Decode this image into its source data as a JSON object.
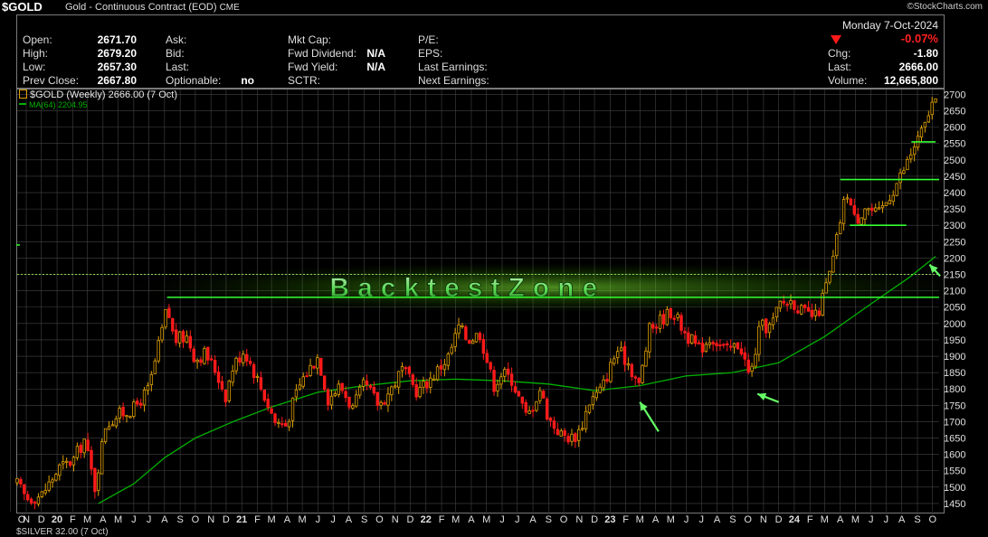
{
  "title": {
    "symbol": "$GOLD",
    "description": "Gold - Continuous Contract (EOD)",
    "exchange": "CME",
    "source": "©StockCharts.com"
  },
  "header": {
    "date": "Monday  7-Oct-2024",
    "change_pct": "-0.07%",
    "open_label": "Open:",
    "open": "2671.70",
    "high_label": "High:",
    "high": "2679.20",
    "low_label": "Low:",
    "low": "2657.30",
    "prev_label": "Prev Close:",
    "prev": "2667.80",
    "ask_label": "Ask:",
    "bid_label": "Bid:",
    "last_label": "Last:",
    "optionable_label": "Optionable:",
    "optionable": "no",
    "mktcap_label": "Mkt Cap:",
    "fwddiv_label": "Fwd Dividend:",
    "fwddiv": "N/A",
    "fwdyield_label": "Fwd Yield:",
    "fwdyield": "N/A",
    "sctr_label": "SCTR:",
    "pe_label": "P/E:",
    "eps_label": "EPS:",
    "lastearn_label": "Last Earnings:",
    "nextearn_label": "Next Earnings:",
    "chg_label": "Chg:",
    "chg": "-1.80",
    "last2_label": "Last:",
    "last2": "2666.00",
    "volume_label": "Volume:",
    "volume": "12,665,800"
  },
  "legend": {
    "price": "$GOLD (Weekly) 2666.00 (7 Oct)",
    "ma": "MA(64) 2204.95"
  },
  "watermark": "BacktestZone",
  "footer": "$SILVER 32.00 (7 Oct)",
  "colors": {
    "up": "#e0a000",
    "down": "#ff1a1a",
    "ma": "#00b000",
    "level": "#33ff33",
    "arrow": "#66ff66",
    "grid": "#444444",
    "axis_text": "#e0e0e0"
  },
  "chart_data": {
    "type": "candlestick",
    "ylim": [
      1425,
      2715
    ],
    "yticks": [
      1450,
      1500,
      1550,
      1600,
      1650,
      1700,
      1750,
      1800,
      1850,
      1900,
      1950,
      2000,
      2050,
      2100,
      2150,
      2200,
      2250,
      2300,
      2350,
      2400,
      2450,
      2500,
      2550,
      2600,
      2650,
      2700
    ],
    "x_range": [
      "2019-10-14",
      "2024-10-14"
    ],
    "x_ticks": [
      {
        "label": "O",
        "date": "2019-10-01"
      },
      {
        "label": "N",
        "date": "2019-11-01"
      },
      {
        "label": "D",
        "date": "2019-12-01"
      },
      {
        "label": "20",
        "date": "2020-01-01"
      },
      {
        "label": "F",
        "date": "2020-02-01"
      },
      {
        "label": "M",
        "date": "2020-03-01"
      },
      {
        "label": "A",
        "date": "2020-04-01"
      },
      {
        "label": "M",
        "date": "2020-05-01"
      },
      {
        "label": "J",
        "date": "2020-06-01"
      },
      {
        "label": "J",
        "date": "2020-07-01"
      },
      {
        "label": "A",
        "date": "2020-08-01"
      },
      {
        "label": "S",
        "date": "2020-09-01"
      },
      {
        "label": "O",
        "date": "2020-10-01"
      },
      {
        "label": "N",
        "date": "2020-11-01"
      },
      {
        "label": "D",
        "date": "2020-12-01"
      },
      {
        "label": "21",
        "date": "2021-01-01"
      },
      {
        "label": "F",
        "date": "2021-02-01"
      },
      {
        "label": "M",
        "date": "2021-03-01"
      },
      {
        "label": "A",
        "date": "2021-04-01"
      },
      {
        "label": "M",
        "date": "2021-05-01"
      },
      {
        "label": "J",
        "date": "2021-06-01"
      },
      {
        "label": "J",
        "date": "2021-07-01"
      },
      {
        "label": "A",
        "date": "2021-08-01"
      },
      {
        "label": "S",
        "date": "2021-09-01"
      },
      {
        "label": "O",
        "date": "2021-10-01"
      },
      {
        "label": "N",
        "date": "2021-11-01"
      },
      {
        "label": "D",
        "date": "2021-12-01"
      },
      {
        "label": "22",
        "date": "2022-01-01"
      },
      {
        "label": "F",
        "date": "2022-02-01"
      },
      {
        "label": "M",
        "date": "2022-03-01"
      },
      {
        "label": "A",
        "date": "2022-04-01"
      },
      {
        "label": "M",
        "date": "2022-05-01"
      },
      {
        "label": "J",
        "date": "2022-06-01"
      },
      {
        "label": "J",
        "date": "2022-07-01"
      },
      {
        "label": "A",
        "date": "2022-08-01"
      },
      {
        "label": "S",
        "date": "2022-09-01"
      },
      {
        "label": "O",
        "date": "2022-10-01"
      },
      {
        "label": "N",
        "date": "2022-11-01"
      },
      {
        "label": "D",
        "date": "2022-12-01"
      },
      {
        "label": "23",
        "date": "2023-01-01"
      },
      {
        "label": "F",
        "date": "2023-02-01"
      },
      {
        "label": "M",
        "date": "2023-03-01"
      },
      {
        "label": "A",
        "date": "2023-04-01"
      },
      {
        "label": "M",
        "date": "2023-05-01"
      },
      {
        "label": "J",
        "date": "2023-06-01"
      },
      {
        "label": "J",
        "date": "2023-07-01"
      },
      {
        "label": "A",
        "date": "2023-08-01"
      },
      {
        "label": "S",
        "date": "2023-09-01"
      },
      {
        "label": "O",
        "date": "2023-10-01"
      },
      {
        "label": "N",
        "date": "2023-11-01"
      },
      {
        "label": "D",
        "date": "2023-12-01"
      },
      {
        "label": "24",
        "date": "2024-01-01"
      },
      {
        "label": "F",
        "date": "2024-02-01"
      },
      {
        "label": "M",
        "date": "2024-03-01"
      },
      {
        "label": "A",
        "date": "2024-04-01"
      },
      {
        "label": "M",
        "date": "2024-05-01"
      },
      {
        "label": "J",
        "date": "2024-06-01"
      },
      {
        "label": "J",
        "date": "2024-07-01"
      },
      {
        "label": "A",
        "date": "2024-08-01"
      },
      {
        "label": "S",
        "date": "2024-09-01"
      },
      {
        "label": "O",
        "date": "2024-10-01"
      }
    ],
    "close_path": [
      [
        "2019-10-14",
        1510
      ],
      [
        "2019-11-01",
        1465
      ],
      [
        "2019-12-01",
        1475
      ],
      [
        "2020-01-06",
        1560
      ],
      [
        "2020-02-01",
        1580
      ],
      [
        "2020-02-24",
        1645
      ],
      [
        "2020-03-16",
        1500
      ],
      [
        "2020-04-06",
        1690
      ],
      [
        "2020-05-01",
        1720
      ],
      [
        "2020-06-01",
        1740
      ],
      [
        "2020-07-01",
        1800
      ],
      [
        "2020-07-20",
        1930
      ],
      [
        "2020-08-06",
        2050
      ],
      [
        "2020-08-20",
        1950
      ],
      [
        "2020-09-15",
        1960
      ],
      [
        "2020-10-01",
        1890
      ],
      [
        "2020-10-20",
        1910
      ],
      [
        "2020-11-09",
        1860
      ],
      [
        "2020-11-30",
        1780
      ],
      [
        "2020-12-15",
        1870
      ],
      [
        "2021-01-06",
        1920
      ],
      [
        "2021-02-01",
        1830
      ],
      [
        "2021-03-08",
        1700
      ],
      [
        "2021-03-30",
        1690
      ],
      [
        "2021-04-15",
        1770
      ],
      [
        "2021-05-01",
        1830
      ],
      [
        "2021-06-01",
        1900
      ],
      [
        "2021-06-21",
        1770
      ],
      [
        "2021-07-15",
        1810
      ],
      [
        "2021-08-09",
        1740
      ],
      [
        "2021-09-01",
        1815
      ],
      [
        "2021-09-30",
        1750
      ],
      [
        "2021-10-20",
        1790
      ],
      [
        "2021-11-15",
        1860
      ],
      [
        "2021-12-15",
        1790
      ],
      [
        "2022-01-15",
        1840
      ],
      [
        "2022-02-15",
        1900
      ],
      [
        "2022-03-07",
        1990
      ],
      [
        "2022-03-25",
        1950
      ],
      [
        "2022-04-18",
        1970
      ],
      [
        "2022-05-15",
        1810
      ],
      [
        "2022-06-01",
        1850
      ],
      [
        "2022-06-20",
        1830
      ],
      [
        "2022-07-20",
        1710
      ],
      [
        "2022-08-15",
        1800
      ],
      [
        "2022-09-01",
        1710
      ],
      [
        "2022-09-26",
        1660
      ],
      [
        "2022-10-20",
        1650
      ],
      [
        "2022-11-04",
        1680
      ],
      [
        "2022-11-20",
        1760
      ],
      [
        "2022-12-15",
        1800
      ],
      [
        "2023-01-15",
        1920
      ],
      [
        "2023-02-06",
        1880
      ],
      [
        "2023-02-27",
        1810
      ],
      [
        "2023-03-20",
        1980
      ],
      [
        "2023-04-10",
        2010
      ],
      [
        "2023-05-04",
        2040
      ],
      [
        "2023-05-30",
        1970
      ],
      [
        "2023-06-26",
        1920
      ],
      [
        "2023-07-20",
        1960
      ],
      [
        "2023-08-20",
        1915
      ],
      [
        "2023-09-15",
        1940
      ],
      [
        "2023-10-05",
        1830
      ],
      [
        "2023-10-25",
        1990
      ],
      [
        "2023-11-15",
        1990
      ],
      [
        "2023-12-04",
        2060
      ],
      [
        "2023-12-28",
        2070
      ],
      [
        "2024-01-20",
        2030
      ],
      [
        "2024-02-15",
        2020
      ],
      [
        "2024-03-01",
        2100
      ],
      [
        "2024-03-15",
        2170
      ],
      [
        "2024-04-05",
        2350
      ],
      [
        "2024-04-15",
        2400
      ],
      [
        "2024-05-01",
        2310
      ],
      [
        "2024-05-20",
        2360
      ],
      [
        "2024-06-15",
        2330
      ],
      [
        "2024-07-15",
        2410
      ],
      [
        "2024-08-05",
        2470
      ],
      [
        "2024-08-25",
        2540
      ],
      [
        "2024-09-15",
        2600
      ],
      [
        "2024-09-28",
        2670
      ],
      [
        "2024-10-07",
        2666
      ]
    ],
    "ma_path": [
      [
        "2020-03-23",
        1450
      ],
      [
        "2020-06-01",
        1510
      ],
      [
        "2020-08-01",
        1590
      ],
      [
        "2020-10-01",
        1650
      ],
      [
        "2020-12-15",
        1700
      ],
      [
        "2021-03-01",
        1745
      ],
      [
        "2021-06-01",
        1790
      ],
      [
        "2021-09-01",
        1810
      ],
      [
        "2021-12-01",
        1825
      ],
      [
        "2022-03-01",
        1830
      ],
      [
        "2022-06-01",
        1825
      ],
      [
        "2022-09-01",
        1815
      ],
      [
        "2022-12-01",
        1795
      ],
      [
        "2023-03-01",
        1810
      ],
      [
        "2023-06-01",
        1840
      ],
      [
        "2023-09-01",
        1850
      ],
      [
        "2023-12-01",
        1880
      ],
      [
        "2024-03-01",
        1960
      ],
      [
        "2024-06-01",
        2060
      ],
      [
        "2024-08-15",
        2140
      ],
      [
        "2024-10-07",
        2205
      ]
    ],
    "levels": [
      {
        "y": 2080,
        "from": "2020-08-06",
        "to": "2024-10-14"
      },
      {
        "y": 2440,
        "from": "2024-04-01",
        "to": "2024-10-14"
      },
      {
        "y": 2300,
        "from": "2024-04-20",
        "to": "2024-08-10"
      },
      {
        "y": 2555,
        "from": "2024-08-20",
        "to": "2024-10-07"
      }
    ],
    "dotted_level": 2150,
    "arrows": [
      {
        "tip_date": "2023-03-01",
        "tip_y": 1760,
        "tail_date": "2023-04-07",
        "tail_y": 1670
      },
      {
        "tip_date": "2023-10-20",
        "tip_y": 1785,
        "tail_date": "2023-12-01",
        "tail_y": 1760
      },
      {
        "tip_date": "2024-09-25",
        "tip_y": 2180,
        "tail_date": "2024-10-16",
        "tail_y": 2145
      }
    ]
  }
}
